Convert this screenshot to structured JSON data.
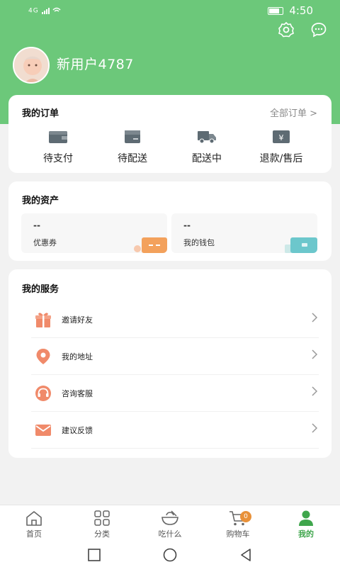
{
  "status": {
    "network": "4G",
    "time": "4:50"
  },
  "user": {
    "name": "新用户4787"
  },
  "orders": {
    "title": "我的订单",
    "all_label": "全部订单 >",
    "items": [
      "待支付",
      "待配送",
      "配送中",
      "退款/售后"
    ]
  },
  "assets": {
    "title": "我的资产",
    "coupon": {
      "value": "--",
      "label": "优惠券"
    },
    "wallet": {
      "value": "--",
      "label": "我的钱包"
    }
  },
  "services": {
    "title": "我的服务",
    "items": [
      "邀请好友",
      "我的地址",
      "咨询客服",
      "建议反馈"
    ]
  },
  "tabs": {
    "home": "首页",
    "category": "分类",
    "eat": "吃什么",
    "cart": "购物车",
    "cart_badge": "0",
    "mine": "我的"
  },
  "colors": {
    "brand": "#6cc87a",
    "active": "#3fa64c",
    "accent": "#f08a6a"
  }
}
